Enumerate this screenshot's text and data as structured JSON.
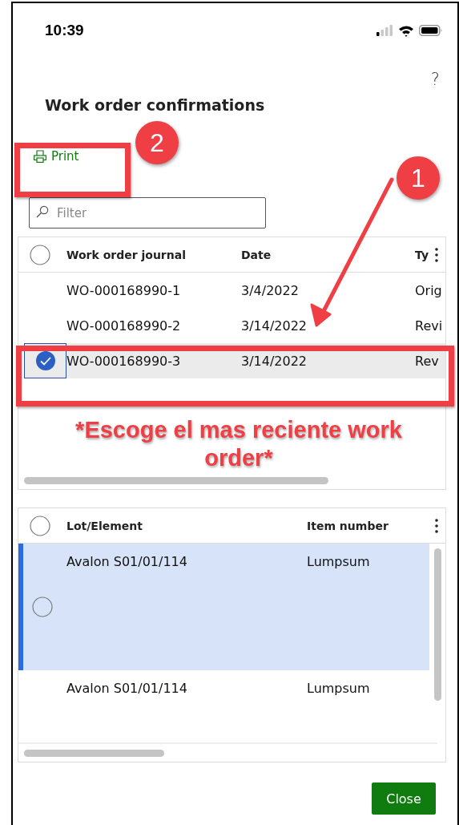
{
  "status_bar": {
    "time": "10:39"
  },
  "help": "?",
  "title": "Work order confirmations",
  "toolbar": [
    {
      "label": "Print",
      "kind": "print"
    }
  ],
  "filter": {
    "placeholder": "Filter"
  },
  "journals": {
    "columns": [
      "Work order journal",
      "Date",
      "Ty"
    ],
    "rows": [
      {
        "cells": [
          "WO-000168990-1",
          "3/4/2022",
          "Orig"
        ],
        "selected": false
      },
      {
        "cells": [
          "WO-000168990-2",
          "3/14/2022",
          "Revi"
        ],
        "selected": false
      },
      {
        "cells": [
          "WO-000168990-3",
          "3/14/2022",
          "Rev"
        ],
        "selected": true
      }
    ]
  },
  "lines": {
    "columns": [
      "Lot/Element",
      "Item number"
    ],
    "rows": [
      {
        "cells": [
          "Avalon S01/01/114",
          "Lumpsum"
        ],
        "selected": true
      },
      {
        "cells": [
          "Avalon S01/01/114",
          "Lumpsum"
        ],
        "selected": false
      }
    ]
  },
  "buttons": [
    {
      "label": "Close"
    }
  ],
  "annotations": {
    "badges": [
      {
        "label": "2"
      },
      {
        "label": "1"
      }
    ],
    "note": "*Escoge el mas reciente work order*"
  }
}
